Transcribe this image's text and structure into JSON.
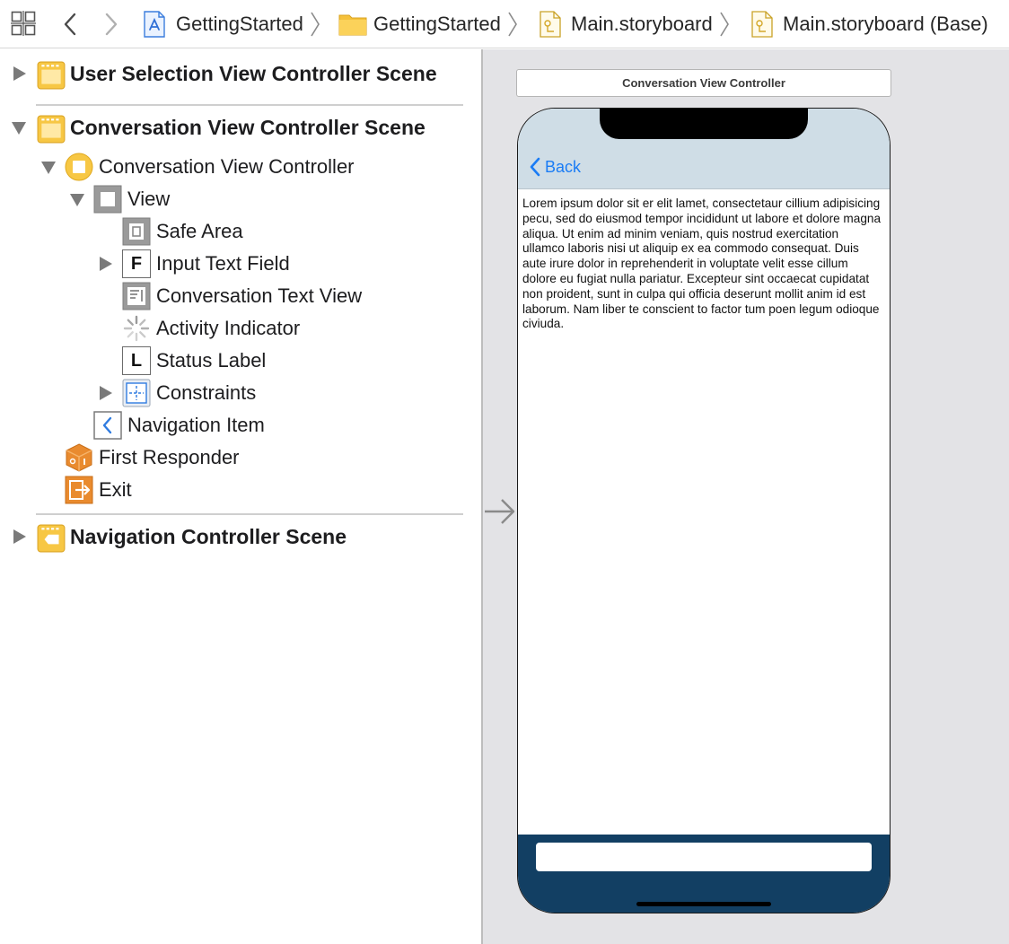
{
  "jumpbar": {
    "crumbs": [
      {
        "label": "GettingStarted"
      },
      {
        "label": "GettingStarted"
      },
      {
        "label": "Main.storyboard"
      },
      {
        "label": "Main.storyboard (Base)"
      }
    ]
  },
  "outline": {
    "scenes": {
      "user_selection": "User Selection View Controller Scene",
      "conversation": "Conversation View Controller Scene",
      "navigation": "Navigation Controller Scene"
    },
    "items": {
      "conversation_vc": "Conversation View Controller",
      "view": "View",
      "safe_area": "Safe Area",
      "input_text_field": "Input Text Field",
      "conversation_text_view": "Conversation Text View",
      "activity_indicator": "Activity Indicator",
      "status_label": "Status Label",
      "constraints": "Constraints",
      "navigation_item": "Navigation Item",
      "first_responder": "First Responder",
      "exit": "Exit"
    },
    "glyphs": {
      "text_field": "F",
      "label": "L"
    }
  },
  "canvas": {
    "scene_title": "Conversation View Controller",
    "back_label": "Back",
    "body_text": "Lorem ipsum dolor sit er elit lamet, consectetaur cillium adipisicing pecu, sed do eiusmod tempor incididunt ut labore et dolore magna aliqua. Ut enim ad minim veniam, quis nostrud exercitation ullamco laboris nisi ut aliquip ex ea commodo consequat. Duis aute irure dolor in reprehenderit in voluptate velit esse cillum dolore eu fugiat nulla pariatur. Excepteur sint occaecat cupidatat non proident, sunt in culpa qui officia deserunt mollit anim id est laborum. Nam liber te conscient to factor tum poen legum odioque civiuda."
  },
  "colors": {
    "accent_blue": "#1a7cf5",
    "scene_yellow": "#f7c744",
    "first_responder_orange": "#e98b2f",
    "bottom_bar": "#123f63",
    "navbar_tint": "#cfdde6"
  }
}
